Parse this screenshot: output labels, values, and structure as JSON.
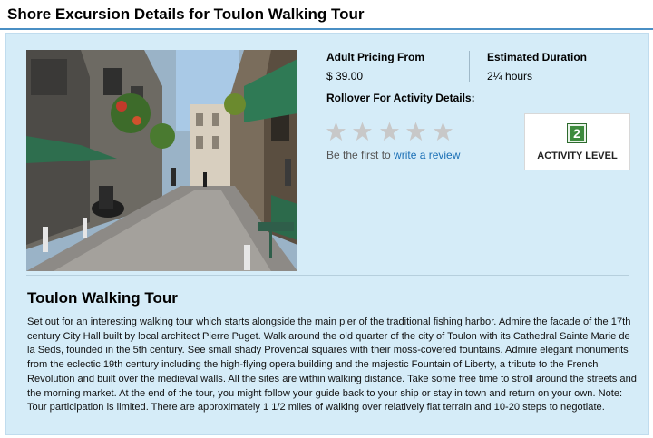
{
  "header": {
    "title": "Shore Excursion Details for Toulon Walking Tour"
  },
  "pricing": {
    "label": "Adult Pricing From",
    "value": "$ 39.00"
  },
  "duration": {
    "label": "Estimated Duration",
    "value": "2¼ hours"
  },
  "rollover": {
    "label": "Rollover For Activity Details:"
  },
  "rating": {
    "stars_filled": 0,
    "stars_total": 5,
    "prefix": "Be the first to",
    "link_text": "write a review"
  },
  "activity": {
    "level": "2",
    "label": "ACTIVITY LEVEL"
  },
  "tour": {
    "title": "Toulon Walking Tour",
    "description": "Set out for an interesting walking tour which starts alongside the main pier of the traditional fishing harbor. Admire the facade of the 17th century City Hall built by local architect Pierre Puget. Walk around the old quarter of the city of Toulon with its Cathedral Sainte Marie de la Seds, founded in the 5th century. See small shady Provencal squares with their moss-covered fountains. Admire elegant monuments from the eclectic 19th century including the high-flying opera building and the majestic Fountain of Liberty, a tribute to the French Revolution and built over the medieval walls. All the sites are within walking distance. Take some free time to stroll around the streets and the morning market. At the end of the tour, you might follow your guide back to your ship or stay in town and return on your own. Note: Tour participation is limited. There are approximately 1 1/2 miles of walking over relatively flat terrain and 10-20 steps to negotiate."
  },
  "colors": {
    "panel_bg": "#d5ecf8",
    "title_rule": "#4a8fc4",
    "link": "#1a6fb5",
    "level_badge": "#3d8b3d",
    "star_empty": "#c8c8c8"
  }
}
